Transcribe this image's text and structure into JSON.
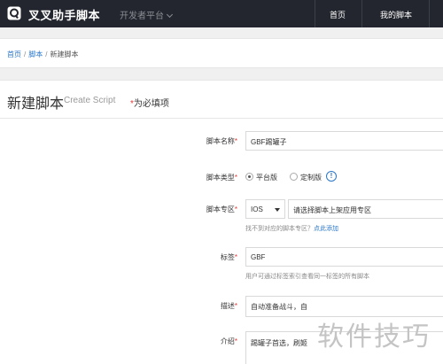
{
  "header": {
    "brand": "叉叉助手脚本",
    "platform": "开发者平台",
    "nav": [
      "首页",
      "我的脚本"
    ]
  },
  "breadcrumb": {
    "home": "首页",
    "sep": "/",
    "scripts": "脚本",
    "current": "新建脚本"
  },
  "page": {
    "title": "新建脚本",
    "subtitle": "Create Script",
    "required_star": "*",
    "required_note": "为必填项"
  },
  "form": {
    "name": {
      "label": "脚本名称",
      "star": "*",
      "value": "GBF踢罐子"
    },
    "type": {
      "label": "脚本类型",
      "star": "*",
      "options": [
        "平台版",
        "定制版"
      ],
      "selected": "平台版",
      "info": "!"
    },
    "zone": {
      "label": "脚本专区",
      "star": "*",
      "os": "IOS",
      "zone_placeholder": "请选择脚本上架应用专区",
      "hint": "找不到对应的脚本专区？",
      "hint_link": "点此添加"
    },
    "tags": {
      "label": "标签",
      "star": "*",
      "value": "GBF",
      "hint": "用户可通过标签索引查看同一标签的所有脚本"
    },
    "desc": {
      "label": "描述",
      "star": "*",
      "value": "自动准备战斗，自"
    },
    "intro": {
      "label": "介绍",
      "star": "*",
      "value": "踢罐子首选，刷姬"
    }
  },
  "watermark": "软件技巧"
}
